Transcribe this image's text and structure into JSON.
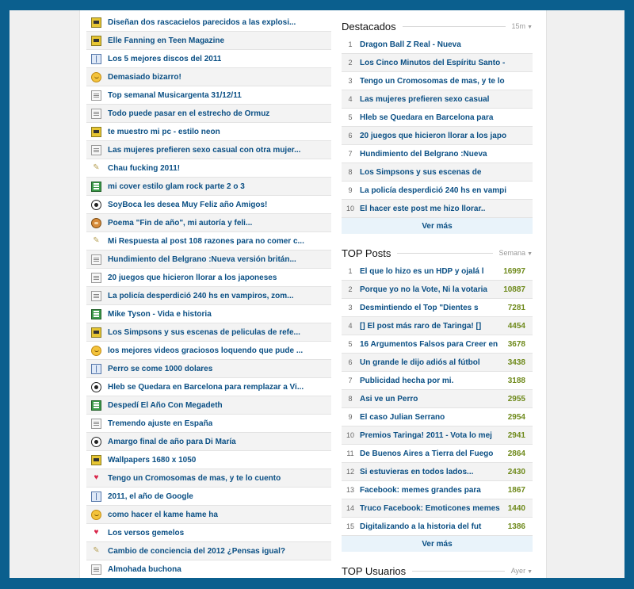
{
  "posts": [
    {
      "icon": "image-icon",
      "cls": "i-img",
      "title": "Diseñan dos rascacielos parecidos a las explosi..."
    },
    {
      "icon": "image-icon",
      "cls": "i-img",
      "title": "Elle Fanning en Teen Magazine"
    },
    {
      "icon": "book-icon",
      "cls": "i-book",
      "title": "Los 5 mejores discos del 2011"
    },
    {
      "icon": "smiley-icon",
      "cls": "i-smile",
      "title": "Demasiado bizarro!"
    },
    {
      "icon": "document-icon",
      "cls": "i-doc",
      "title": "Top semanal Musicargenta 31/12/11"
    },
    {
      "icon": "document-icon",
      "cls": "i-doc",
      "title": "Todo puede pasar en el estrecho de Ormuz"
    },
    {
      "icon": "image-icon",
      "cls": "i-img",
      "title": "te muestro mi pc - estilo neon"
    },
    {
      "icon": "document-icon",
      "cls": "i-doc",
      "title": "Las mujeres prefieren sexo casual con otra mujer..."
    },
    {
      "icon": "pencil-icon",
      "cls": "i-pencil",
      "title": "Chau fucking 2011!"
    },
    {
      "icon": "music-icon",
      "cls": "i-music",
      "title": "mi cover estilo glam rock parte 2 o 3"
    },
    {
      "icon": "soccer-ball-icon",
      "cls": "i-soccer",
      "title": "SoyBoca les desea Muy Feliz año Amigos!"
    },
    {
      "icon": "monkey-icon",
      "cls": "i-monkey",
      "title": "Poema \"Fin de año\", mi autoría y feli..."
    },
    {
      "icon": "pencil-icon",
      "cls": "i-pencil",
      "title": "Mi Respuesta al post 108 razones para no comer c..."
    },
    {
      "icon": "document-icon",
      "cls": "i-doc",
      "title": "Hundimiento del Belgrano :Nueva versión britán..."
    },
    {
      "icon": "document-icon",
      "cls": "i-doc",
      "title": "20 juegos que hicieron llorar a los japoneses"
    },
    {
      "icon": "document-icon",
      "cls": "i-doc",
      "title": "La policía desperdició 240 hs en vampiros, zom..."
    },
    {
      "icon": "music-icon",
      "cls": "i-music",
      "title": "Mike Tyson - Vida e historia"
    },
    {
      "icon": "image-icon",
      "cls": "i-img",
      "title": "Los Simpsons y sus escenas de peliculas de refe..."
    },
    {
      "icon": "smiley-icon",
      "cls": "i-smile",
      "title": "los mejores videos graciosos loquendo que pude ..."
    },
    {
      "icon": "book-icon",
      "cls": "i-book",
      "title": "Perro se come 1000 dolares"
    },
    {
      "icon": "soccer-ball-icon",
      "cls": "i-soccer",
      "title": "Hleb se Quedara en Barcelona para remplazar a Vi..."
    },
    {
      "icon": "music-icon",
      "cls": "i-music",
      "title": "Despedí El Año Con Megadeth"
    },
    {
      "icon": "document-icon",
      "cls": "i-doc",
      "title": "Tremendo ajuste en España"
    },
    {
      "icon": "soccer-ball-icon",
      "cls": "i-soccer",
      "title": "Amargo final de año para Di María"
    },
    {
      "icon": "image-icon",
      "cls": "i-img",
      "title": "Wallpapers 1680 x 1050"
    },
    {
      "icon": "heart-icon",
      "cls": "i-heart",
      "title": "Tengo un Cromosomas de mas, y te lo cuento"
    },
    {
      "icon": "book-icon",
      "cls": "i-book",
      "title": "2011, el año de Google"
    },
    {
      "icon": "smiley-icon",
      "cls": "i-smile",
      "title": "como hacer el kame hame ha"
    },
    {
      "icon": "heart-icon",
      "cls": "i-heart",
      "title": "Los versos gemelos"
    },
    {
      "icon": "pencil-icon",
      "cls": "i-pencil",
      "title": "Cambio de conciencia del 2012 ¿Pensas igual?"
    },
    {
      "icon": "document-icon",
      "cls": "i-doc",
      "title": "Almohada buchona"
    }
  ],
  "destacados": {
    "title": "Destacados",
    "filter": "15m",
    "items": [
      {
        "n": "1",
        "title": "Dragon Ball Z Real - Nueva"
      },
      {
        "n": "2",
        "title": "Los Cinco Minutos del Espíritu Santo -"
      },
      {
        "n": "3",
        "title": "Tengo un Cromosomas de mas, y te lo"
      },
      {
        "n": "4",
        "title": "Las mujeres prefieren sexo casual"
      },
      {
        "n": "5",
        "title": "Hleb se Quedara en Barcelona para"
      },
      {
        "n": "6",
        "title": "20 juegos que hicieron llorar a los japo"
      },
      {
        "n": "7",
        "title": "Hundimiento del Belgrano :Nueva"
      },
      {
        "n": "8",
        "title": "Los Simpsons y sus escenas de"
      },
      {
        "n": "9",
        "title": "La policía desperdició 240 hs en vampi"
      },
      {
        "n": "10",
        "title": "El hacer este post me hizo llorar.."
      }
    ],
    "more": "Ver más"
  },
  "top_posts": {
    "title": "TOP Posts",
    "filter": "Semana",
    "items": [
      {
        "n": "1",
        "title": "El que lo hizo es un HDP y ojalá l",
        "score": "16997"
      },
      {
        "n": "2",
        "title": "Porque yo no la Vote, Ni la votaria",
        "score": "10887"
      },
      {
        "n": "3",
        "title": "Desmintiendo el Top \"Dientes s",
        "score": "7281"
      },
      {
        "n": "4",
        "title": "[] El post más raro de Taringa! []",
        "score": "4454"
      },
      {
        "n": "5",
        "title": "16 Argumentos Falsos para Creer en",
        "score": "3678"
      },
      {
        "n": "6",
        "title": "Un grande le dijo adiós al fútbol",
        "score": "3438"
      },
      {
        "n": "7",
        "title": "Publicidad hecha por mi.",
        "score": "3188"
      },
      {
        "n": "8",
        "title": "Asi ve un Perro",
        "score": "2955"
      },
      {
        "n": "9",
        "title": "El caso Julian Serrano",
        "score": "2954"
      },
      {
        "n": "10",
        "title": "Premios Taringa! 2011 - Vota lo mej",
        "score": "2941"
      },
      {
        "n": "11",
        "title": "De Buenos Aires a Tierra del Fuego",
        "score": "2864"
      },
      {
        "n": "12",
        "title": "Si estuvieras en todos lados...",
        "score": "2430"
      },
      {
        "n": "13",
        "title": "Facebook: memes grandes para",
        "score": "1867"
      },
      {
        "n": "14",
        "title": "Truco Facebook: Emoticones memes",
        "score": "1440"
      },
      {
        "n": "15",
        "title": "Digitalizando a la historia del fut",
        "score": "1386"
      }
    ],
    "more": "Ver más"
  },
  "top_usuarios": {
    "title": "TOP Usuarios",
    "filter": "Ayer"
  },
  "colors": {
    "link": "#0a4f84",
    "score": "#6f8a1c",
    "frame": "#0b5f8e"
  }
}
